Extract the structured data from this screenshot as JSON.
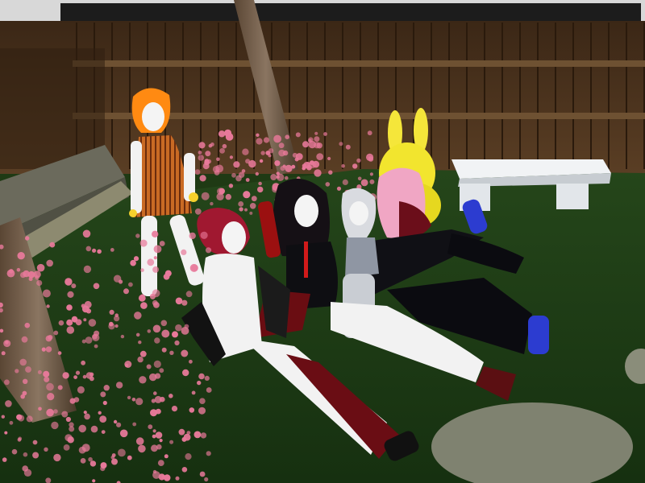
{
  "scene": {
    "title": "",
    "setting": "garden-courtyard",
    "objects": [
      "wooden-fence",
      "stone-wall",
      "tree-trunk",
      "cherry-blossom-bush",
      "white-bench",
      "stepping-stone"
    ],
    "avatars": [
      {
        "name": "",
        "hair": "orange",
        "outfit": "striped-orange-dress"
      },
      {
        "name": "",
        "hair": "crimson",
        "outfit": "nude-white-skin-bat-wings"
      },
      {
        "name": "",
        "hair": "black",
        "outfit": "black-red-jacket"
      },
      {
        "name": "",
        "hair": "silver",
        "outfit": "grey-top"
      },
      {
        "name": "",
        "hair": "pink",
        "outfit": "black-tracksuit"
      },
      {
        "name": "",
        "hair": "",
        "outfit": "yellow-rabbit-costume"
      }
    ]
  },
  "colors": {
    "grass": "#1f3a14",
    "fence": "#4a3420",
    "blossom": "#e8799a",
    "bench": "#e9ecef",
    "stone": "#7f8270",
    "skin": "#f2f2f2"
  }
}
